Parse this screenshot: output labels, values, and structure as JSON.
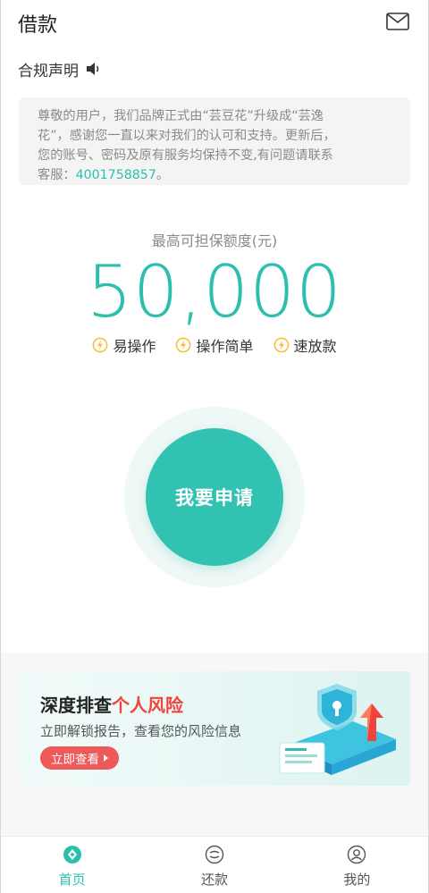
{
  "header": {
    "title": "借款",
    "mail_icon": "mail-icon"
  },
  "notice": {
    "label": "合规声明",
    "speaker_icon": "speaker-icon",
    "line1": "尊敬的用户，我们品牌正式由“芸豆花”升级成“芸逸",
    "line2": "花”，感谢您一直以来对我们的认可和支持。更新后，",
    "line3": "您的账号、密码及原有服务均保持不变,有问题请联系",
    "line4_prefix": "客服：",
    "phone": "4001758857",
    "line4_suffix": "。"
  },
  "limit": {
    "label": "最高可担保额度(元)",
    "amount": "50,000"
  },
  "features": [
    {
      "icon": "lightning-icon",
      "label": "易操作"
    },
    {
      "icon": "lightning-icon",
      "label": "操作简单"
    },
    {
      "icon": "lightning-icon",
      "label": "速放款"
    }
  ],
  "apply": {
    "label": "我要申请"
  },
  "risk_card": {
    "title_prefix": "深度排查",
    "title_highlight": "个人风险",
    "subtitle": "立即解锁报告，查看您的风险信息",
    "button": "立即查看"
  },
  "tabs": [
    {
      "icon": "home-icon",
      "label": "首页",
      "active": true
    },
    {
      "icon": "repay-icon",
      "label": "还款",
      "active": false
    },
    {
      "icon": "profile-icon",
      "label": "我的",
      "active": false
    }
  ],
  "colors": {
    "accent": "#2dbfae",
    "highlight_red": "#f0433a",
    "button_red": "#ee5a5a",
    "feature_yellow": "#f5c33b"
  }
}
